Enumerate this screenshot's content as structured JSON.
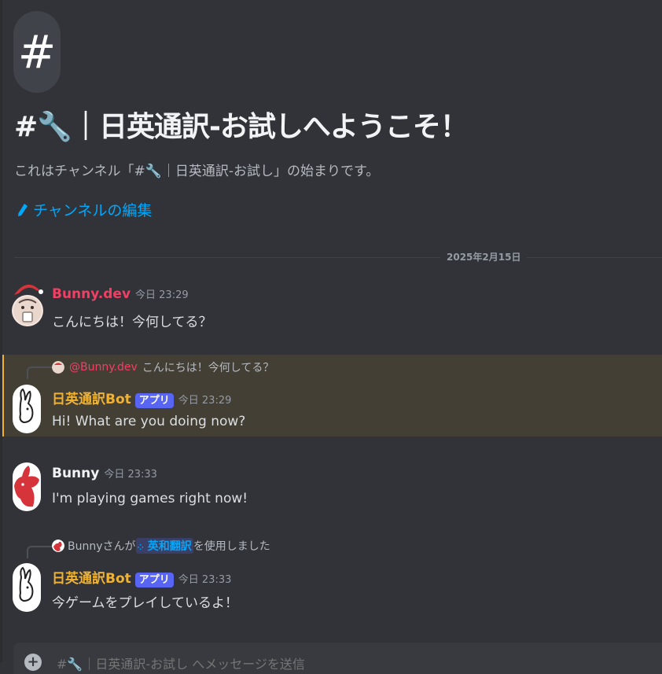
{
  "channel": {
    "icon": "hash-icon",
    "welcome_title": "#🔧｜日英通訳-お試しへようこそ！",
    "welcome_subtitle": "これはチャンネル「#🔧｜日英通訳-お試し」の始まりです。",
    "edit_label": "チャンネルの編集"
  },
  "divider": {
    "date": "2025年2月15日"
  },
  "messages": [
    {
      "author": "Bunny.dev",
      "author_color": "#f23f63",
      "time": "今日 23:29",
      "text": "こんにちは！今何してる？"
    },
    {
      "reply": {
        "mention": "@Bunny.dev",
        "text": "こんにちは！今何してる？"
      },
      "author": "日英通訳Bot",
      "author_color": "#f0b232",
      "badge": "アプリ",
      "time": "今日 23:29",
      "text": "Hi! What are you doing now?"
    },
    {
      "author": "Bunny",
      "author_color": "#f2f3f5",
      "time": "今日 23:33",
      "text": "I'm playing games right now!"
    },
    {
      "interaction": {
        "user": "Bunnyさんが",
        "command": "英和翻訳",
        "suffix": "を使用しました"
      },
      "author": "日英通訳Bot",
      "author_color": "#f0b232",
      "badge": "アプリ",
      "time": "今日 23:33",
      "text": "今ゲームをプレイしているよ！"
    }
  ],
  "composer": {
    "placeholder": "#🔧｜日英通訳-お試し へメッセージを送信"
  }
}
